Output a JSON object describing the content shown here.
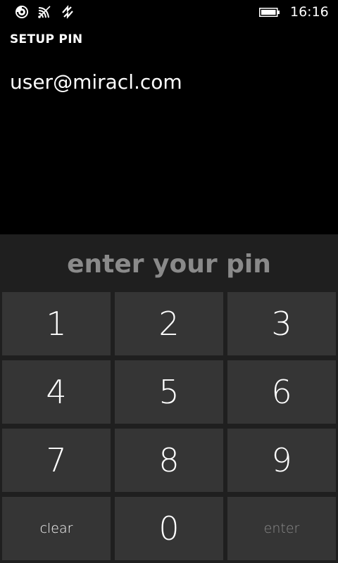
{
  "status_bar": {
    "icons": [
      "notification-icon",
      "wifi-icon",
      "data-sync-icon",
      "battery-icon"
    ],
    "time": "16:16"
  },
  "header": {
    "title": "SETUP PIN"
  },
  "account": {
    "email": "user@miracl.com"
  },
  "pin_entry": {
    "prompt": "enter your pin",
    "keys": [
      {
        "label": "1"
      },
      {
        "label": "2"
      },
      {
        "label": "3"
      },
      {
        "label": "4"
      },
      {
        "label": "5"
      },
      {
        "label": "6"
      },
      {
        "label": "7"
      },
      {
        "label": "8"
      },
      {
        "label": "9"
      },
      {
        "label": "clear"
      },
      {
        "label": "0"
      },
      {
        "label": "enter"
      }
    ]
  },
  "colors": {
    "background": "#000000",
    "panel": "#1f1f1f",
    "key": "#353535",
    "prompt_text": "#8a8a8a",
    "disabled_text": "#8a8a8a"
  }
}
